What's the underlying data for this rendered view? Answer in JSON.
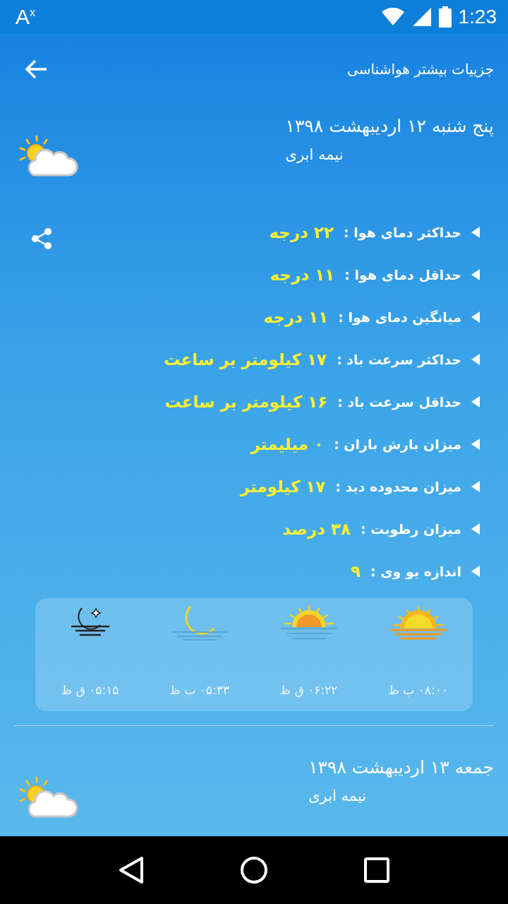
{
  "status_bar": {
    "notification": "A$^{x}$",
    "time": "1:23"
  },
  "app_bar": {
    "title": "جزییات بیشتر هواشناسی"
  },
  "days": [
    {
      "date": "پنج شنبه ۱۲ اردیبهشت ۱۳۹۸",
      "condition": "نیمه ابری",
      "details": [
        {
          "label": "حداکثر دمای هوا :",
          "value": "۲۲ درجه"
        },
        {
          "label": "حداقل دمای هوا :",
          "value": "۱۱ درجه"
        },
        {
          "label": "میانگین دمای هوا :",
          "value": "۱۱ درجه"
        },
        {
          "label": "حداکثر سرعت باد :",
          "value": "۱۷ کیلومتر بر ساعت"
        },
        {
          "label": "حداقل سرعت باد :",
          "value": "۱۶ کیلومتر بر ساعت"
        },
        {
          "label": "میزان بارش باران :",
          "value": "۰ میلیمتر"
        },
        {
          "label": "میزان محدوده دید :",
          "value": "۱۷ کیلومتر"
        },
        {
          "label": "میزان رطوبت :",
          "value": "۳۸ درصد"
        },
        {
          "label": "اندازه یو وی :",
          "value": "۹"
        }
      ],
      "times": [
        {
          "kind": "sunrise",
          "time": "۰۸:۰۰ ب ظ"
        },
        {
          "kind": "sunset",
          "time": "۰۶:۲۲ ق ظ"
        },
        {
          "kind": "moonrise",
          "time": "۰۵:۳۳ ب ظ"
        },
        {
          "kind": "moonset",
          "time": "۰۵:۱۵ ق ظ"
        }
      ]
    },
    {
      "date": "جمعه ۱۳ اردیبهشت ۱۳۹۸",
      "condition": "نیمه ابری"
    }
  ]
}
